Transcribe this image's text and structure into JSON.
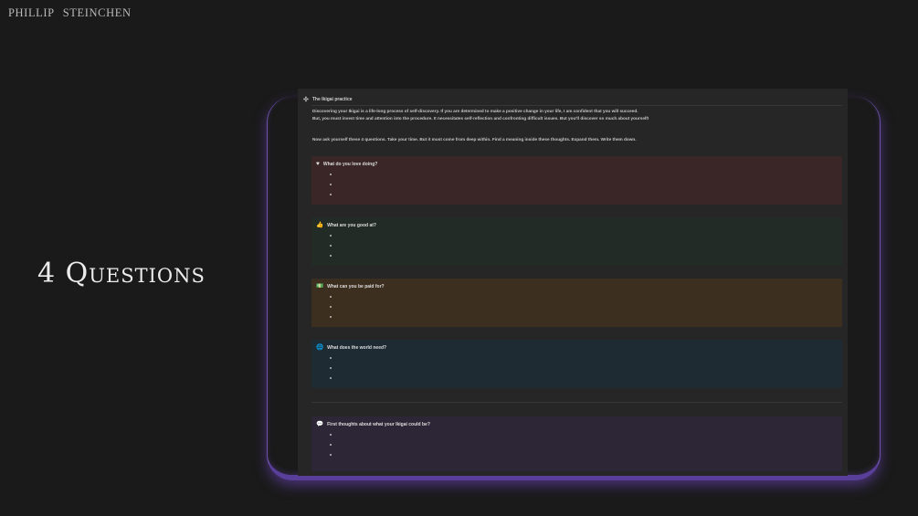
{
  "brand": {
    "first": "PHILLIP",
    "last": "STEINCHEN"
  },
  "headline": "4 Questions",
  "page": {
    "icon": "compass-icon",
    "title": "The Ikigai practice",
    "intro_line1": "Discovering your Ikigai is a life-long process of self-discovery. If you are determined to make a positive change in your life, I am confident that you will succeed.",
    "intro_line2": "But, you must invest time and attention into the procedure. It necessitates self-reflection and confronting difficult issues. But you'll discover so much about yourself!",
    "instruction": "Now ask yourself these 4 questions. Take your time. But it must come from deep within. Find a meaning inside these thoughts. Expand them. Write them down."
  },
  "callouts": [
    {
      "icon": "heart-icon",
      "glyph": "♥",
      "color": "#3a2626",
      "title": "What do you love doing?"
    },
    {
      "icon": "thumbs-up-icon",
      "glyph": "👍",
      "color": "#222b26",
      "title": "What are you good at?"
    },
    {
      "icon": "money-icon",
      "glyph": "💵",
      "color": "#3d2f20",
      "title": "What can you be paid for?"
    },
    {
      "icon": "globe-icon",
      "glyph": "🌐",
      "color": "#1f2b33",
      "title": "What does the world need?"
    },
    {
      "icon": "speech-bubble-icon",
      "glyph": "💬",
      "color": "#2d2636",
      "title": "First thoughts about what your Ikigai could be?"
    }
  ]
}
